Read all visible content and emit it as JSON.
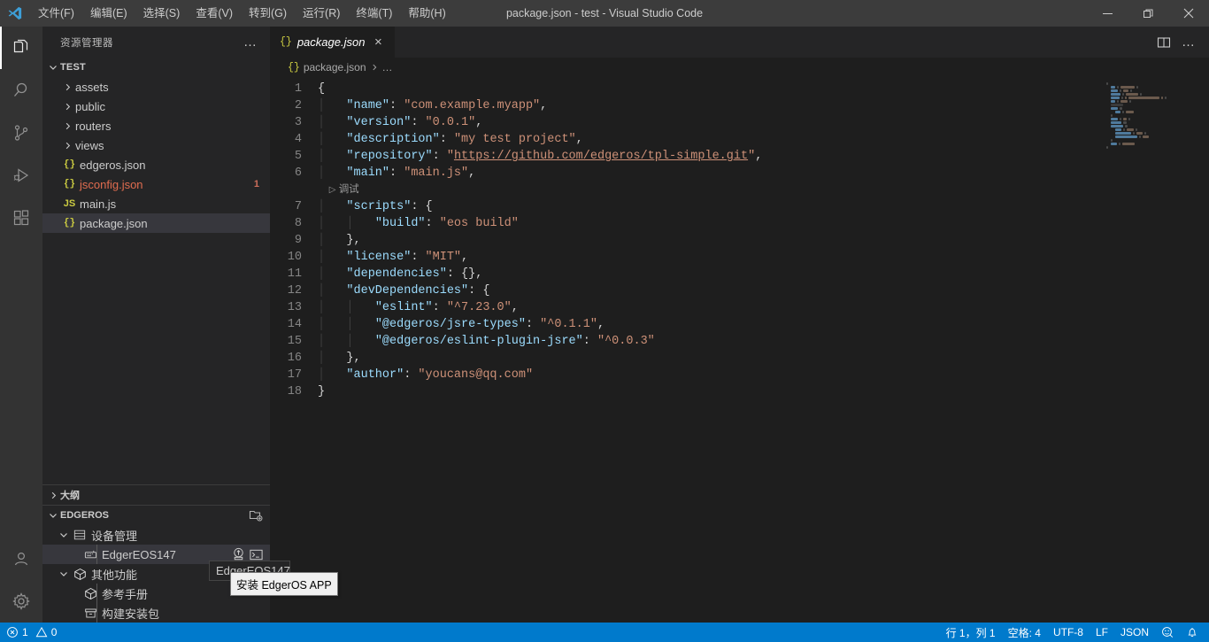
{
  "window": {
    "title": "package.json - test - Visual Studio Code",
    "controls": {
      "minimize": "minimize-icon",
      "restore": "restore-icon",
      "close": "close-icon"
    }
  },
  "menu": {
    "items": [
      {
        "label": "文件(F)",
        "name": "menu-file"
      },
      {
        "label": "编辑(E)",
        "name": "menu-edit"
      },
      {
        "label": "选择(S)",
        "name": "menu-selection"
      },
      {
        "label": "查看(V)",
        "name": "menu-view"
      },
      {
        "label": "转到(G)",
        "name": "menu-goto"
      },
      {
        "label": "运行(R)",
        "name": "menu-run"
      },
      {
        "label": "终端(T)",
        "name": "menu-terminal"
      },
      {
        "label": "帮助(H)",
        "name": "menu-help"
      }
    ]
  },
  "activitybar": {
    "items": [
      {
        "icon": "files-explorer-icon",
        "active": true
      },
      {
        "icon": "search-icon",
        "active": false
      },
      {
        "icon": "source-control-icon",
        "active": false
      },
      {
        "icon": "run-and-debug-icon",
        "active": false
      },
      {
        "icon": "extensions-icon",
        "active": false
      }
    ],
    "bottom": [
      {
        "icon": "account-icon"
      },
      {
        "icon": "settings-gear-icon"
      }
    ]
  },
  "sidebar": {
    "title": "资源管理器",
    "more_actions": "…",
    "explorer": {
      "root_label": "TEST",
      "items": [
        {
          "label": "assets",
          "type": "folder",
          "icon": "chevron-right-icon",
          "badge": ""
        },
        {
          "label": "public",
          "type": "folder",
          "icon": "chevron-right-icon",
          "badge": ""
        },
        {
          "label": "routers",
          "type": "folder",
          "icon": "chevron-right-icon",
          "badge": ""
        },
        {
          "label": "views",
          "type": "folder",
          "icon": "chevron-right-icon",
          "badge": ""
        },
        {
          "label": "edgeros.json",
          "type": "json",
          "icon": "json-file-icon",
          "badge": ""
        },
        {
          "label": "jsconfig.json",
          "type": "json-warn",
          "icon": "json-file-icon",
          "badge": "1"
        },
        {
          "label": "main.js",
          "type": "js",
          "icon": "js-file-icon",
          "badge": ""
        },
        {
          "label": "package.json",
          "type": "json",
          "icon": "json-file-icon",
          "badge": "",
          "selected": true
        }
      ]
    },
    "outline": {
      "label": "大纲"
    },
    "edgeros": {
      "label": "EDGEROS",
      "action_icon": "new-project-folder-icon",
      "nodes": [
        {
          "label": "设备管理",
          "icon": "server-rack-icon",
          "level": 1,
          "expanded": true
        },
        {
          "label": "EdgerEOS147",
          "icon": "device-icon",
          "level": 2,
          "selected": true,
          "actions": [
            {
              "icon": "install-app-icon",
              "tooltip": "安装 EdgerOS APP"
            },
            {
              "icon": "terminal-icon"
            }
          ]
        },
        {
          "label": "其他功能",
          "icon": "package-icon",
          "level": 1,
          "expanded": true
        },
        {
          "label": "参考手册",
          "icon": "package-icon",
          "level": 2
        },
        {
          "label": "构建安装包",
          "icon": "archive-icon",
          "level": 2
        }
      ],
      "hover_title": "EdgerEOS147",
      "tooltip": "安装 EdgerOS APP"
    }
  },
  "editor": {
    "tab": {
      "label": "package.json",
      "icon": "json-file-icon",
      "close": "×"
    },
    "actions": [
      {
        "icon": "split-editor-right-icon"
      },
      {
        "icon": "more-actions-icon",
        "label": "…"
      }
    ],
    "breadcrumbs": [
      {
        "icon": "json-file-icon",
        "label": "package.json"
      },
      {
        "label": "…"
      }
    ],
    "codelens": {
      "label": "调试",
      "icon": "play-icon"
    },
    "line_numbers": [
      "1",
      "2",
      "3",
      "4",
      "5",
      "6",
      "",
      "7",
      "8",
      "9",
      "10",
      "11",
      "12",
      "13",
      "14",
      "15",
      "16",
      "17",
      "18"
    ],
    "lines": [
      {
        "n": "1",
        "indent": 0,
        "tokens": [
          {
            "t": "{",
            "c": "p"
          }
        ]
      },
      {
        "n": "2",
        "indent": 1,
        "tokens": [
          {
            "t": "\"name\"",
            "c": "k"
          },
          {
            "t": ": ",
            "c": "p"
          },
          {
            "t": "\"com.example.myapp\"",
            "c": "s"
          },
          {
            "t": ",",
            "c": "p"
          }
        ]
      },
      {
        "n": "3",
        "indent": 1,
        "tokens": [
          {
            "t": "\"version\"",
            "c": "k"
          },
          {
            "t": ": ",
            "c": "p"
          },
          {
            "t": "\"0.0.1\"",
            "c": "s"
          },
          {
            "t": ",",
            "c": "p"
          }
        ]
      },
      {
        "n": "4",
        "indent": 1,
        "tokens": [
          {
            "t": "\"description\"",
            "c": "k"
          },
          {
            "t": ": ",
            "c": "p"
          },
          {
            "t": "\"my test project\"",
            "c": "s"
          },
          {
            "t": ",",
            "c": "p"
          }
        ]
      },
      {
        "n": "5",
        "indent": 1,
        "tokens": [
          {
            "t": "\"repository\"",
            "c": "k"
          },
          {
            "t": ": ",
            "c": "p"
          },
          {
            "t": "\"",
            "c": "s"
          },
          {
            "t": "https://github.com/edgeros/tpl-simple.git",
            "c": "lnk"
          },
          {
            "t": "\"",
            "c": "s"
          },
          {
            "t": ",",
            "c": "p"
          }
        ]
      },
      {
        "n": "6",
        "indent": 1,
        "tokens": [
          {
            "t": "\"main\"",
            "c": "k"
          },
          {
            "t": ": ",
            "c": "p"
          },
          {
            "t": "\"main.js\"",
            "c": "s"
          },
          {
            "t": ",",
            "c": "p"
          }
        ]
      },
      {
        "n": "",
        "indent": 1,
        "codelens": true
      },
      {
        "n": "7",
        "indent": 1,
        "tokens": [
          {
            "t": "\"scripts\"",
            "c": "k"
          },
          {
            "t": ": {",
            "c": "p"
          }
        ]
      },
      {
        "n": "8",
        "indent": 2,
        "tokens": [
          {
            "t": "\"build\"",
            "c": "k"
          },
          {
            "t": ": ",
            "c": "p"
          },
          {
            "t": "\"eos build\"",
            "c": "s"
          }
        ]
      },
      {
        "n": "9",
        "indent": 1,
        "tokens": [
          {
            "t": "},",
            "c": "p"
          }
        ]
      },
      {
        "n": "10",
        "indent": 1,
        "tokens": [
          {
            "t": "\"license\"",
            "c": "k"
          },
          {
            "t": ": ",
            "c": "p"
          },
          {
            "t": "\"MIT\"",
            "c": "s"
          },
          {
            "t": ",",
            "c": "p"
          }
        ]
      },
      {
        "n": "11",
        "indent": 1,
        "tokens": [
          {
            "t": "\"dependencies\"",
            "c": "k"
          },
          {
            "t": ": {},",
            "c": "p"
          }
        ]
      },
      {
        "n": "12",
        "indent": 1,
        "tokens": [
          {
            "t": "\"devDependencies\"",
            "c": "k"
          },
          {
            "t": ": {",
            "c": "p"
          }
        ]
      },
      {
        "n": "13",
        "indent": 2,
        "tokens": [
          {
            "t": "\"eslint\"",
            "c": "k"
          },
          {
            "t": ": ",
            "c": "p"
          },
          {
            "t": "\"^7.23.0\"",
            "c": "s"
          },
          {
            "t": ",",
            "c": "p"
          }
        ]
      },
      {
        "n": "14",
        "indent": 2,
        "tokens": [
          {
            "t": "\"@edgeros/jsre-types\"",
            "c": "k"
          },
          {
            "t": ": ",
            "c": "p"
          },
          {
            "t": "\"^0.1.1\"",
            "c": "s"
          },
          {
            "t": ",",
            "c": "p"
          }
        ]
      },
      {
        "n": "15",
        "indent": 2,
        "tokens": [
          {
            "t": "\"@edgeros/eslint-plugin-jsre\"",
            "c": "k"
          },
          {
            "t": ": ",
            "c": "p"
          },
          {
            "t": "\"^0.0.3\"",
            "c": "s"
          }
        ]
      },
      {
        "n": "16",
        "indent": 1,
        "tokens": [
          {
            "t": "},",
            "c": "p"
          }
        ]
      },
      {
        "n": "17",
        "indent": 1,
        "tokens": [
          {
            "t": "\"author\"",
            "c": "k"
          },
          {
            "t": ": ",
            "c": "p"
          },
          {
            "t": "\"youcans@qq.com\"",
            "c": "s"
          }
        ]
      },
      {
        "n": "18",
        "indent": 0,
        "tokens": [
          {
            "t": "}",
            "c": "p"
          }
        ]
      }
    ]
  },
  "statusbar": {
    "left": [
      {
        "name": "problems",
        "error_icon": "error-circle-icon",
        "errors": "1",
        "warning_icon": "warning-triangle-icon",
        "warnings": "0"
      }
    ],
    "right": [
      {
        "name": "cursor-position",
        "label": "行 1，列 1"
      },
      {
        "name": "indentation",
        "label": "空格: 4"
      },
      {
        "name": "encoding",
        "label": "UTF-8"
      },
      {
        "name": "eol",
        "label": "LF"
      },
      {
        "name": "language-mode",
        "label": "JSON"
      },
      {
        "name": "feedback",
        "icon": "feedback-smiley-icon"
      },
      {
        "name": "notifications",
        "icon": "bell-icon"
      }
    ]
  },
  "colors": {
    "accent": "#007acc",
    "titlebar_bg": "#3c3c3c",
    "sidebar_bg": "#252526",
    "activitybar_bg": "#333333",
    "editor_bg": "#1e1e1e",
    "key": "#9cdcfe",
    "string": "#ce9178",
    "punct": "#d4d4d4",
    "badge": "#cc6e5b"
  }
}
